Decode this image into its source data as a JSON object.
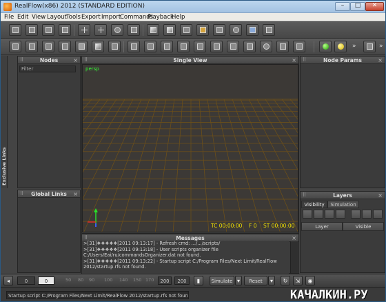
{
  "window": {
    "title": "RealFlow(x86) 2012  (STANDARD EDITION)",
    "controls": {
      "minimize": "–",
      "maximize": "□",
      "close": "✕"
    }
  },
  "menu": [
    "File",
    "Edit",
    "View",
    "Layout",
    "Tools",
    "Export",
    "Import",
    "Commands",
    "Playback",
    "Help"
  ],
  "panels": {
    "nodes": {
      "title": "Nodes",
      "filter_placeholder": "Filter"
    },
    "exclusive_links": {
      "title": "Exclusive Links"
    },
    "global_links": {
      "title": "Global Links"
    },
    "single_view": {
      "title": "Single View"
    },
    "node_params": {
      "title": "Node Params"
    },
    "messages": {
      "title": "Messages"
    },
    "layers": {
      "title": "Layers",
      "tabs": [
        "Visibility",
        "Simulation"
      ],
      "columns": [
        "Layer",
        "Visible"
      ]
    }
  },
  "viewport": {
    "camera_label": "persp",
    "timecode": "TC 00:00:00",
    "frame": "F 0",
    "sim_time": "ST 00:00:00",
    "colors": {
      "grid": "#6b4f1a",
      "overlay_text": "#f1e000",
      "camera_label": "#35ff35"
    }
  },
  "messages": [
    ">[31]❖❖❖❖❖[2011 09:13:17] - Refresh cmd: .../.../scripts/",
    ">[31]❖❖❖❖❖[2011 09:13:18] - User scripts organizer file",
    "C:/Users/Eai/ru/commandsOrganizer.dat not found.",
    ">[31]❖❖❖❖❖[2011 09:13:22] - Startup script C:/Program Files/Next Limit/RealFlow",
    "2012/startup.rfs not found."
  ],
  "timeline": {
    "start_frame": "0",
    "current_frame": "0",
    "ticks": [
      "50",
      "80",
      "90",
      "100",
      "140",
      "150",
      "170"
    ],
    "end_frame": "200",
    "max_frame": "200",
    "simulate_label": "Simulate",
    "reset_label": "Reset"
  },
  "status": {
    "text": "Startup script C:/Program Files/Next Limit/RealFlow 2012/startup.rfs not found."
  },
  "watermark": {
    "text": "КАЧАЛКИН.РУ"
  }
}
